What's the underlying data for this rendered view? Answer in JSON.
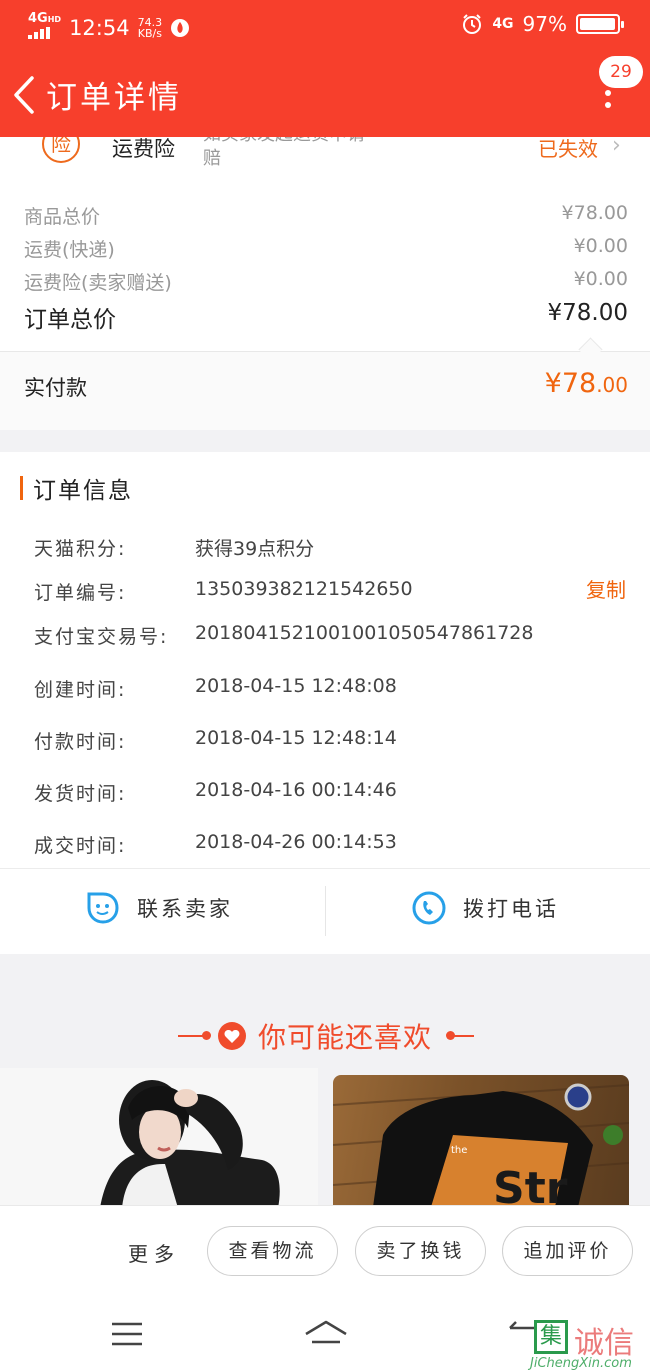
{
  "status_bar": {
    "network": "4G",
    "network_hd": "HD",
    "time": "12:54",
    "speed_value": "74.3",
    "speed_unit": "KB/s",
    "battery": "97%",
    "net_right": "4G",
    "battery_level": 0.97
  },
  "header": {
    "title": "订单详情",
    "badge": "29",
    "color": "#f73f2c"
  },
  "insurance": {
    "icon_char": "险",
    "name": "运费险",
    "desc_line1": "如买家发起退货申请",
    "desc_line2": "赔",
    "status": "已失效"
  },
  "price": {
    "goods_label": "商品总价",
    "goods_value": "¥78.00",
    "freight_label": "运费(快递)",
    "freight_value": "¥0.00",
    "insurance_label": "运费险(卖家赠送)",
    "insurance_value": "¥0.00",
    "total_label": "订单总价",
    "total_value": "¥78.00",
    "paid_label": "实付款",
    "paid_symbol": "¥",
    "paid_int": "78",
    "paid_dec": ".00",
    "accent": "#f0650f"
  },
  "order_info": {
    "title": "订单信息",
    "copy_label": "复制",
    "rows": [
      {
        "label": "天猫积分:",
        "value": "获得39点积分"
      },
      {
        "label": "订单编号:",
        "value": "135039382121542650"
      },
      {
        "label": "支付宝交易号:",
        "value": "2018041521001001050547861728"
      },
      {
        "label": "创建时间:",
        "value": "2018-04-15 12:48:08"
      },
      {
        "label": "付款时间:",
        "value": "2018-04-15 12:48:14"
      },
      {
        "label": "发货时间:",
        "value": "2018-04-16 00:14:46"
      },
      {
        "label": "成交时间:",
        "value": "2018-04-26 00:14:53"
      }
    ],
    "contact_seller": "联系卖家",
    "call_phone": "拨打电话"
  },
  "recommend": {
    "title": "你可能还喜欢"
  },
  "actions": {
    "more": "更多",
    "logistics": "查看物流",
    "resell": "卖了换钱",
    "review": "追加评价"
  },
  "watermark": {
    "char": "集",
    "text": "诚信",
    "sub": "JiChengXin.com"
  }
}
